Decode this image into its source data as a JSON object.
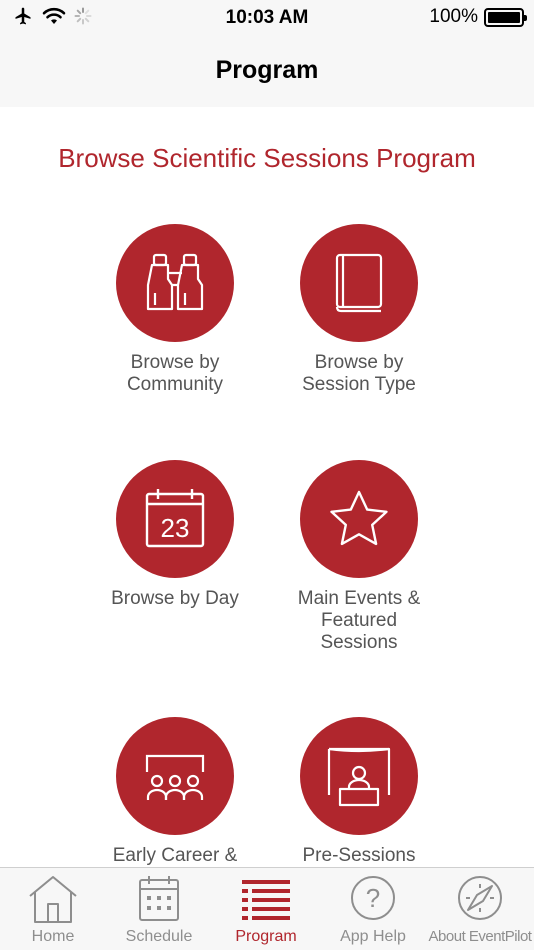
{
  "status_bar": {
    "time": "10:03 AM",
    "battery": "100%",
    "icons": [
      "airplane-icon",
      "wifi-icon",
      "activity-spinner-icon",
      "battery-icon"
    ]
  },
  "nav": {
    "title": "Program"
  },
  "main": {
    "section_title": "Browse Scientific Sessions Program",
    "tiles": [
      {
        "icon": "binoculars-icon",
        "label_line1": "Browse by",
        "label_line2": "Community",
        "label_line3": ""
      },
      {
        "icon": "book-icon",
        "label_line1": "Browse by",
        "label_line2": "Session Type",
        "label_line3": ""
      },
      {
        "icon": "calendar-icon",
        "calendar_number": "23",
        "label_line1": "Browse by Day",
        "label_line2": "",
        "label_line3": ""
      },
      {
        "icon": "star-icon",
        "label_line1": "Main Events &",
        "label_line2": "Featured",
        "label_line3": "Sessions"
      },
      {
        "icon": "group-icon",
        "label_line1": "Early Career &",
        "label_line2": "",
        "label_line3": ""
      },
      {
        "icon": "presenter-icon",
        "label_line1": "Pre-Sessions",
        "label_line2": "",
        "label_line3": ""
      }
    ]
  },
  "tab_bar": {
    "active": "Program",
    "tabs": [
      {
        "label": "Home",
        "icon": "home-icon"
      },
      {
        "label": "Schedule",
        "icon": "calendar-icon"
      },
      {
        "label": "Program",
        "icon": "list-icon"
      },
      {
        "label": "App Help",
        "icon": "help-icon"
      },
      {
        "label": "About EventPilot",
        "icon": "compass-icon"
      }
    ]
  },
  "colors": {
    "accent": "#b0262d",
    "bar_background": "#f7f7f7",
    "inactive_tab": "#8e8e8e",
    "label_text": "#555555"
  }
}
